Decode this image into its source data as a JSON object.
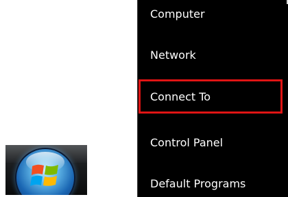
{
  "taskbar": {
    "start_button_icon": "windows-logo-icon"
  },
  "start_menu": {
    "items": [
      {
        "label": "Computer"
      },
      {
        "label": "Network"
      },
      {
        "label": "Connect To"
      },
      {
        "label": "Control Panel"
      },
      {
        "label": "Default Programs"
      }
    ],
    "highlighted_item": "Connect To",
    "highlight_color": "#e01414",
    "background_color": "#000000",
    "text_color": "#ffffff"
  }
}
